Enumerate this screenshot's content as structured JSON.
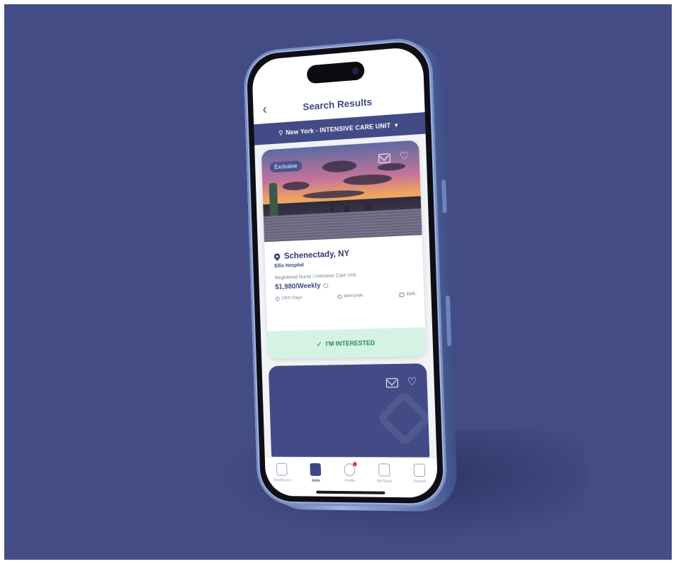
{
  "app": {
    "header_title": "Search Results",
    "search": {
      "location": "New York",
      "separator": " - ",
      "specialty": "INTENSIVE CARE UNIT"
    }
  },
  "job_card": {
    "badge": "Exclusive",
    "city": "Schenectady, NY",
    "facility": "Ellis Hospital",
    "role": "Registered Nurse / Intensive Care Unit",
    "pay": "$1,980/Weekly",
    "shift": "10Hr Days",
    "hours": "40Hrs/Wk",
    "duration": "8Wk",
    "interested_label": "I'M INTERESTED"
  },
  "tabbar": {
    "items": [
      {
        "label": "Dashboard",
        "icon": "dashboard-icon",
        "active": false
      },
      {
        "label": "Jobs",
        "icon": "briefcase-icon",
        "active": true
      },
      {
        "label": "Profile",
        "icon": "profile-icon",
        "active": false
      },
      {
        "label": "MyTasks",
        "icon": "tasks-icon",
        "active": false
      },
      {
        "label": "Payroll",
        "icon": "payroll-icon",
        "active": false
      }
    ]
  },
  "colors": {
    "background": "#444c86",
    "brand_navy": "#3d4680",
    "interested_bg": "#d4f3e4",
    "interested_text": "#2a8a57",
    "notification": "#e53a3a"
  }
}
